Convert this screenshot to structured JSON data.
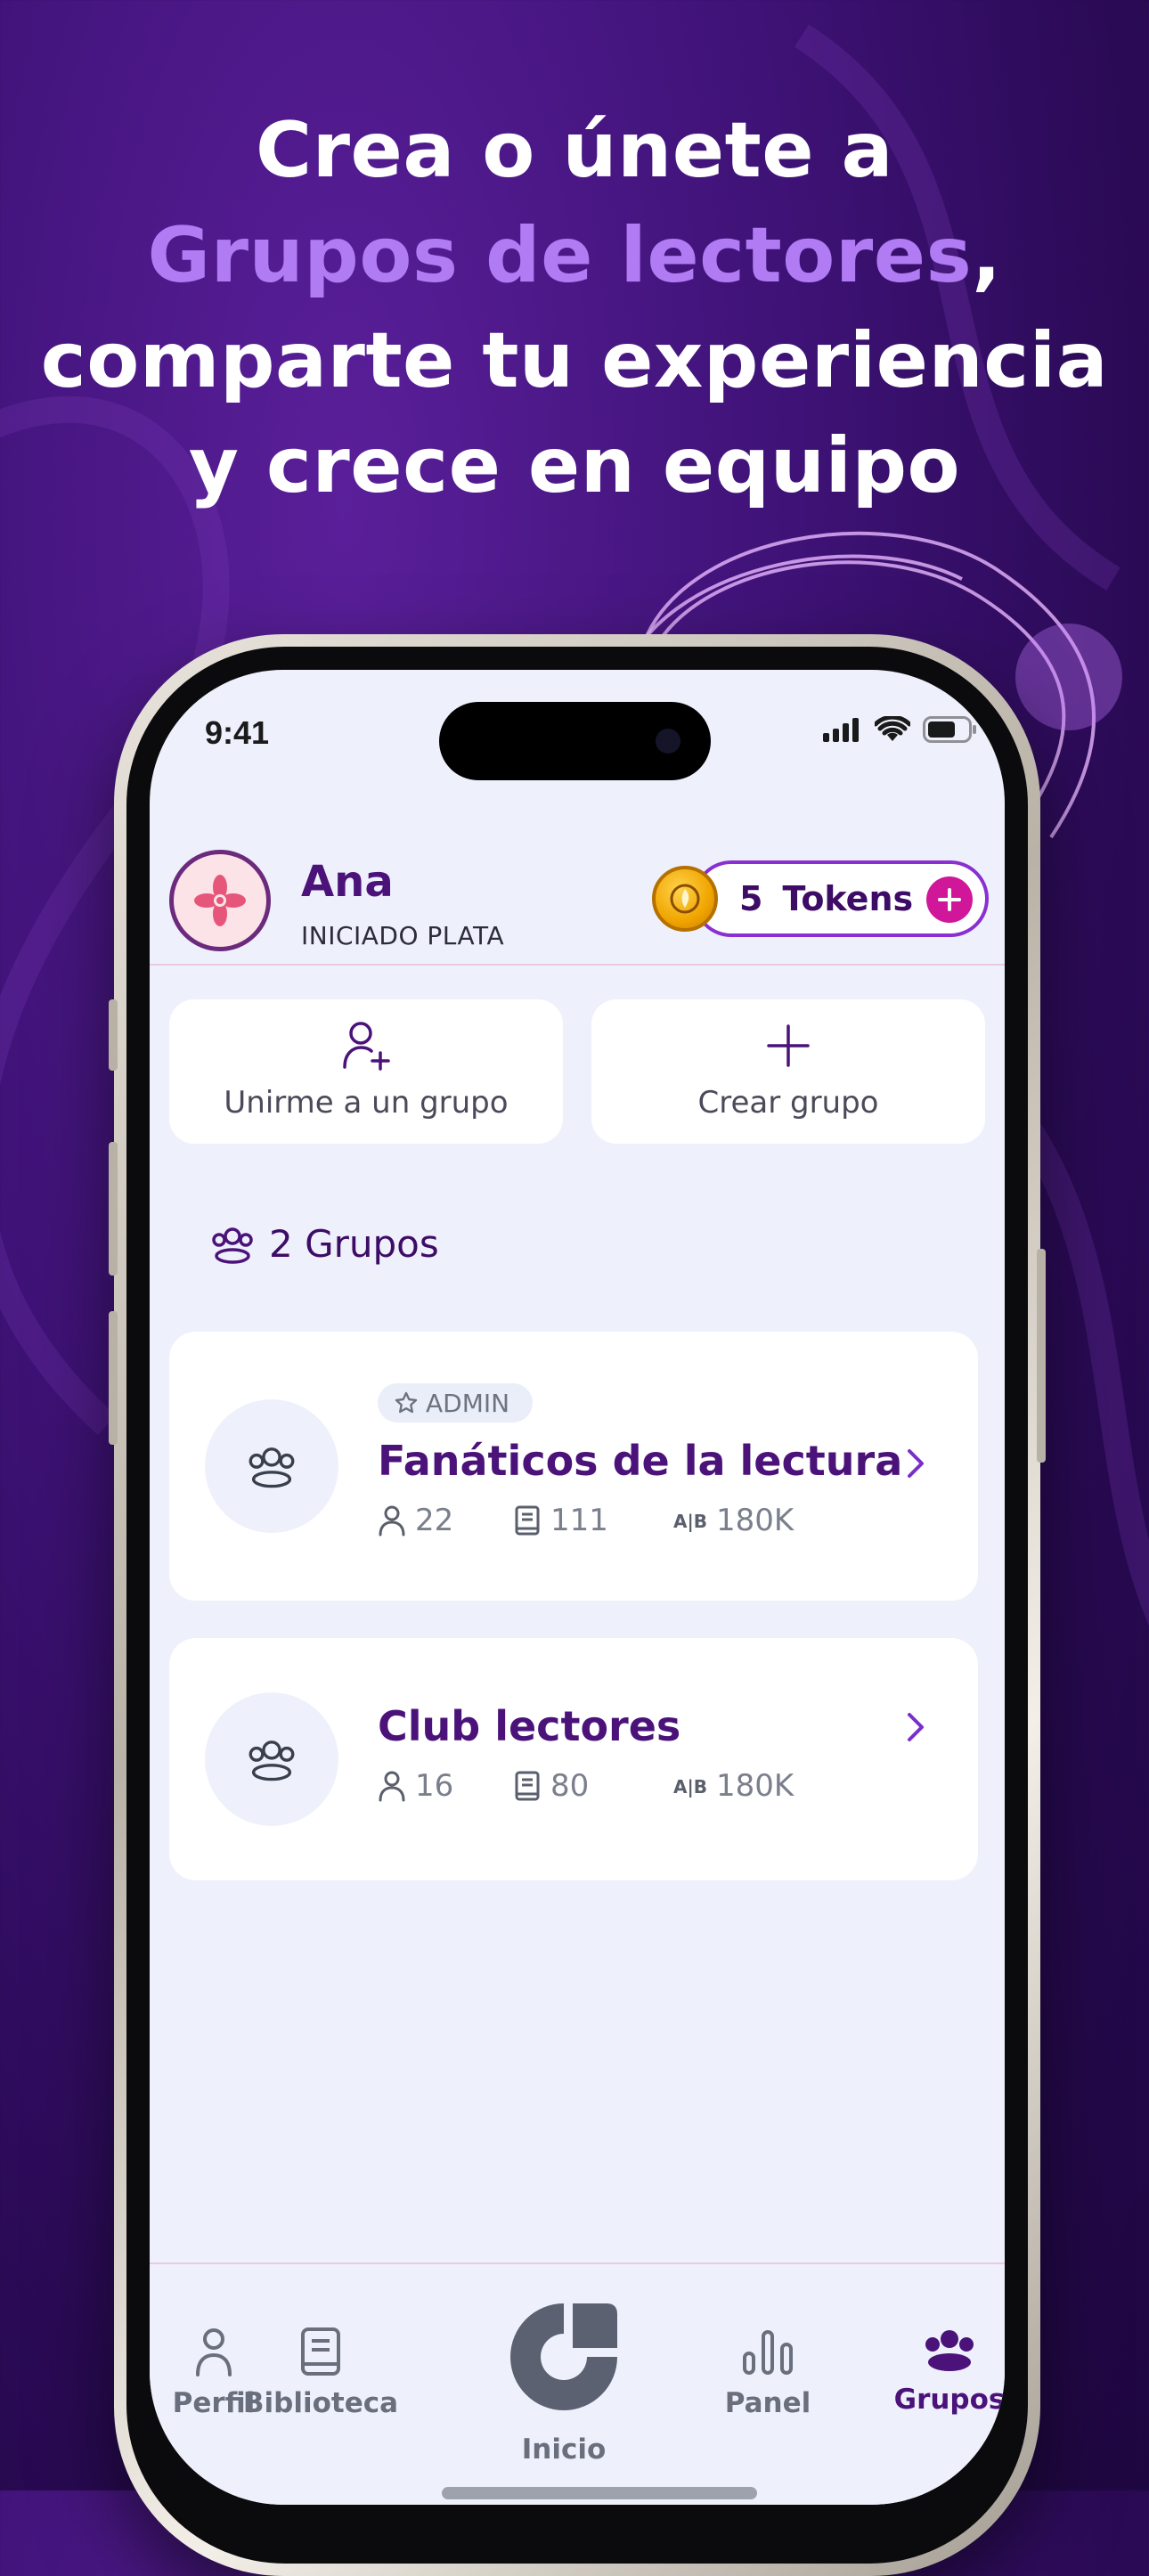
{
  "headline": {
    "line1": "Crea o únete a",
    "line2_accent": "Grupos de lectores",
    "line2_rest": ",",
    "line3": "comparte tu experiencia",
    "line4": "y crece en equipo"
  },
  "status_bar": {
    "time": "9:41"
  },
  "header": {
    "user_name": "Ana",
    "user_rank": "INICIADO PLATA",
    "tokens_count": "5",
    "tokens_label": "Tokens"
  },
  "actions": {
    "join_label": "Unirme a un grupo",
    "create_label": "Crear grupo"
  },
  "groups": {
    "count_label": "2 Grupos",
    "items": [
      {
        "badge": "ADMIN",
        "title": "Fanáticos de la lectura",
        "members": "22",
        "books": "111",
        "words": "180K"
      },
      {
        "title": "Club lectores",
        "members": "16",
        "books": "80",
        "words": "180K"
      }
    ]
  },
  "nav": {
    "profile": "Perfil",
    "library": "Biblioteca",
    "home": "Inicio",
    "panel": "Panel",
    "groups": "Grupos"
  },
  "colors": {
    "brand_purple": "#4b137a",
    "accent_light_purple": "#b07bf3",
    "token_border": "#8a2fd1",
    "token_plus": "#d0179a",
    "coin_gold": "#f0a500"
  }
}
